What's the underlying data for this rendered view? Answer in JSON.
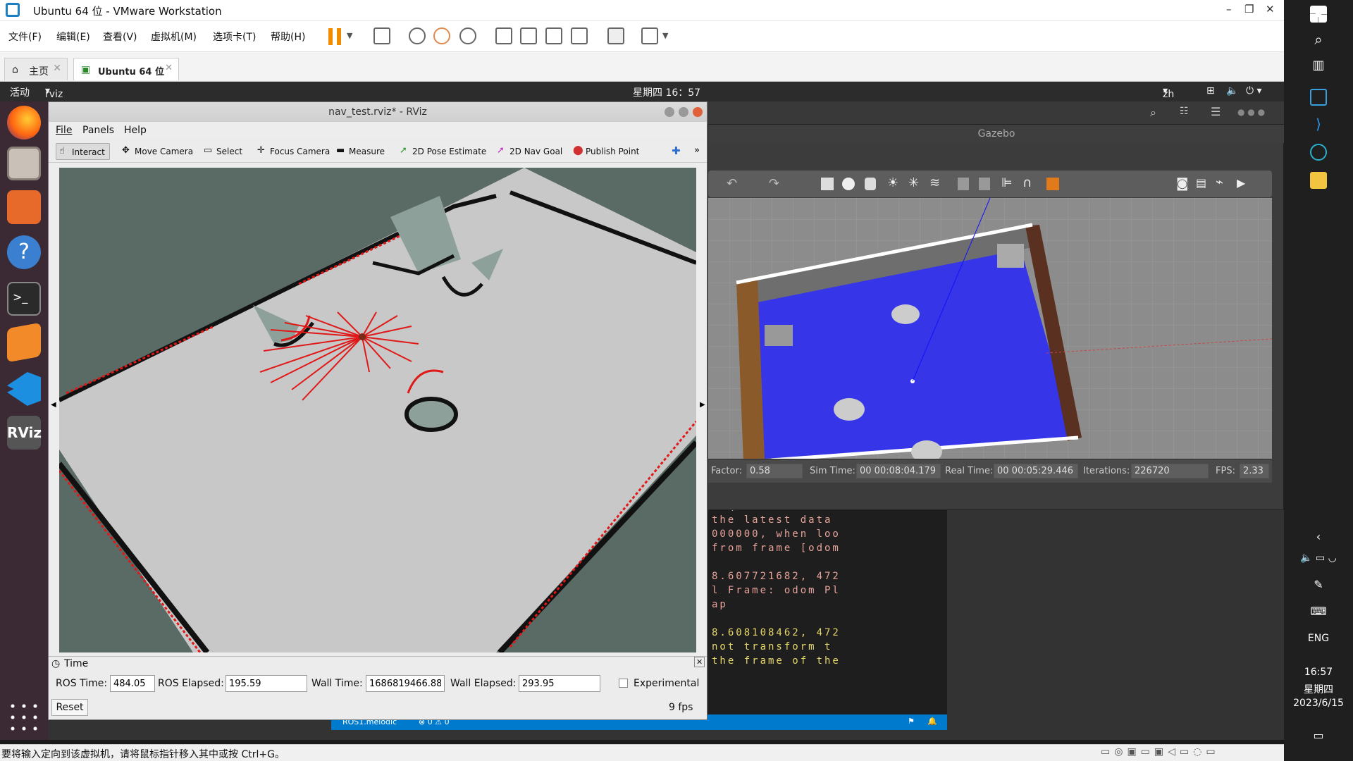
{
  "vmware": {
    "title": "Ubuntu 64 位 - VMware Workstation",
    "menu": [
      "文件(F)",
      "编辑(E)",
      "查看(V)",
      "虚拟机(M)",
      "选项卡(T)",
      "帮助(H)"
    ],
    "tabs": [
      {
        "label": "主页"
      },
      {
        "label": "Ubuntu 64 位"
      }
    ],
    "status_text": "要将输入定向到该虚拟机，请将鼠标指针移入其中或按 Ctrl+G。"
  },
  "ubuntu": {
    "activities": "活动",
    "app_name": "rviz",
    "clock": "星期四 16：57",
    "lang": "zh"
  },
  "rviz": {
    "title": "nav_test.rviz* - RViz",
    "menu": [
      "File",
      "Panels",
      "Help"
    ],
    "tools": [
      {
        "label": "Interact",
        "icon": "hand-icon"
      },
      {
        "label": "Move Camera",
        "icon": "move-icon"
      },
      {
        "label": "Select",
        "icon": "select-icon"
      },
      {
        "label": "Focus Camera",
        "icon": "focus-icon"
      },
      {
        "label": "Measure",
        "icon": "ruler-icon"
      },
      {
        "label": "2D Pose Estimate",
        "icon": "pose-arrow-icon"
      },
      {
        "label": "2D Nav Goal",
        "icon": "goal-arrow-icon"
      },
      {
        "label": "Publish Point",
        "icon": "pin-icon"
      }
    ],
    "time_panel": {
      "title": "Time",
      "ros_time_label": "ROS Time:",
      "ros_time": "484.05",
      "ros_elapsed_label": "ROS Elapsed:",
      "ros_elapsed": "195.59",
      "wall_time_label": "Wall Time:",
      "wall_time": "1686819466.88",
      "wall_elapsed_label": "Wall Elapsed:",
      "wall_elapsed": "293.95",
      "experimental_label": "Experimental",
      "reset_label": "Reset",
      "fps": "9 fps"
    }
  },
  "gazebo": {
    "title": "Gazebo",
    "stats": {
      "factor_label": "Factor:",
      "factor": "0.58",
      "sim_time_label": "Sim Time:",
      "sim_time": "00 00:08:04.179",
      "real_time_label": "Real Time:",
      "real_time": "00 00:05:29.446",
      "iterations_label": "Iterations:",
      "iterations": "226720",
      "fps_label": "FPS:",
      "fps": "2.33"
    }
  },
  "terminal": {
    "lines": [
      {
        "text": "Requested time",
        "color": "#e7a39a"
      },
      {
        "text": "the latest data",
        "color": "#e7a39a"
      },
      {
        "text": "000000, when loo",
        "color": "#e7a39a"
      },
      {
        "text": "from frame [odom",
        "color": "#e7a39a"
      },
      {
        "text": "",
        "color": "#e7a39a"
      },
      {
        "text": "8.607721682, 472",
        "color": "#e7a39a"
      },
      {
        "text": "l Frame: odom Pl",
        "color": "#e7a39a"
      },
      {
        "text": "ap",
        "color": "#e7a39a"
      },
      {
        "text": "",
        "color": "#e7a39a"
      },
      {
        "text": "8.608108462, 472",
        "color": "#e5d66a"
      },
      {
        "text": "not transform t",
        "color": "#e5d66a"
      },
      {
        "text": "the frame of the",
        "color": "#e5d66a"
      }
    ],
    "status_left": "ROS1.melodic",
    "status_counts": "⊗ 0 ⚠ 0"
  },
  "windows": {
    "lang": "ENG",
    "time": "16:57",
    "weekday": "星期四",
    "date": "2023/6/15"
  }
}
